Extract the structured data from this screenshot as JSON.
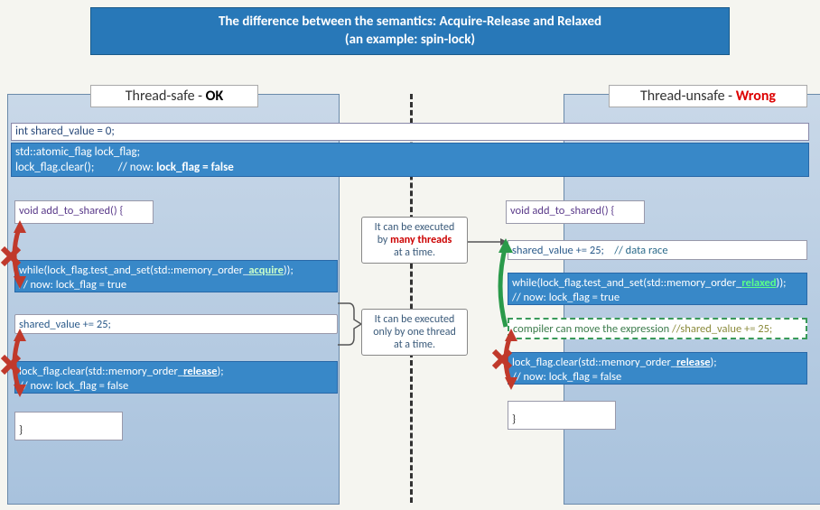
{
  "header": {
    "line1": "The difference between the semantics: Acquire-Release and Relaxed",
    "line2": "(an example: spin-lock)"
  },
  "left": {
    "title_prefix": "Thread-safe - ",
    "title_status": "OK",
    "fn_sig": "void add_to_shared() {",
    "while_line": "while(lock_flag.test_and_set(std::memory_order_",
    "while_kw": "acquire",
    "while_tail": "));",
    "while_comment": "// now: lock_flag = true",
    "shared_inc": "shared_value += 25;",
    "clear_line": "lock_flag.clear(std::memory_order_",
    "clear_kw": "release",
    "clear_tail": ");",
    "clear_comment": "// now: lock_flag = false",
    "close": "}"
  },
  "right": {
    "title_prefix": "Thread-unsafe - ",
    "title_status": "Wrong",
    "fn_sig": "void add_to_shared() {",
    "race_line": "shared_value += 25;",
    "race_comment": "// data race",
    "while_line": "while(lock_flag.test_and_set(std::memory_order_",
    "while_kw": "relaxed",
    "while_tail": "));",
    "while_comment": "// now: lock_flag = true",
    "moved_line": "compiler can move the expression ",
    "moved_comment": "//shared_value += 25;",
    "clear_line": "lock_flag.clear(std::memory_order_",
    "clear_kw": "release",
    "clear_tail": ");",
    "clear_comment": "// now: lock_flag = false",
    "close": "}"
  },
  "shared_decl": "int shared_value = 0;",
  "flag_decl_line1": "std::atomic_flag lock_flag;",
  "flag_decl_line2a": "lock_flag.clear();",
  "flag_decl_line2b": "// now: ",
  "flag_decl_line2c": "lock_flag = false",
  "info_many_1": "It can be executed",
  "info_many_2": "by ",
  "info_many_3": "many threads",
  "info_many_4": "at a time.",
  "info_one_1": "It can be executed",
  "info_one_2": "only by one thread",
  "info_one_3": "at a time."
}
